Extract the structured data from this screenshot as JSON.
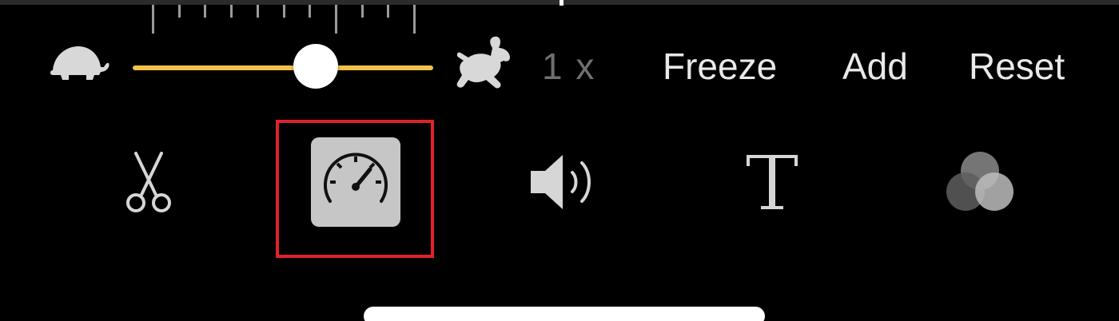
{
  "speed_control": {
    "slow_icon": "turtle-icon",
    "fast_icon": "hare-icon",
    "slider_position_fraction": 0.61,
    "speed_label": "1 x",
    "accent_color": "#f2c14a"
  },
  "actions": {
    "freeze_label": "Freeze",
    "add_label": "Add",
    "reset_label": "Reset"
  },
  "toolbar": {
    "tools": [
      {
        "icon": "scissors-icon",
        "selected": false
      },
      {
        "icon": "speedometer-icon",
        "selected": true
      },
      {
        "icon": "speaker-icon",
        "selected": false
      },
      {
        "icon": "title-text-icon",
        "selected": false
      },
      {
        "icon": "filters-icon",
        "selected": false
      }
    ],
    "highlight_color": "#e0222a"
  }
}
